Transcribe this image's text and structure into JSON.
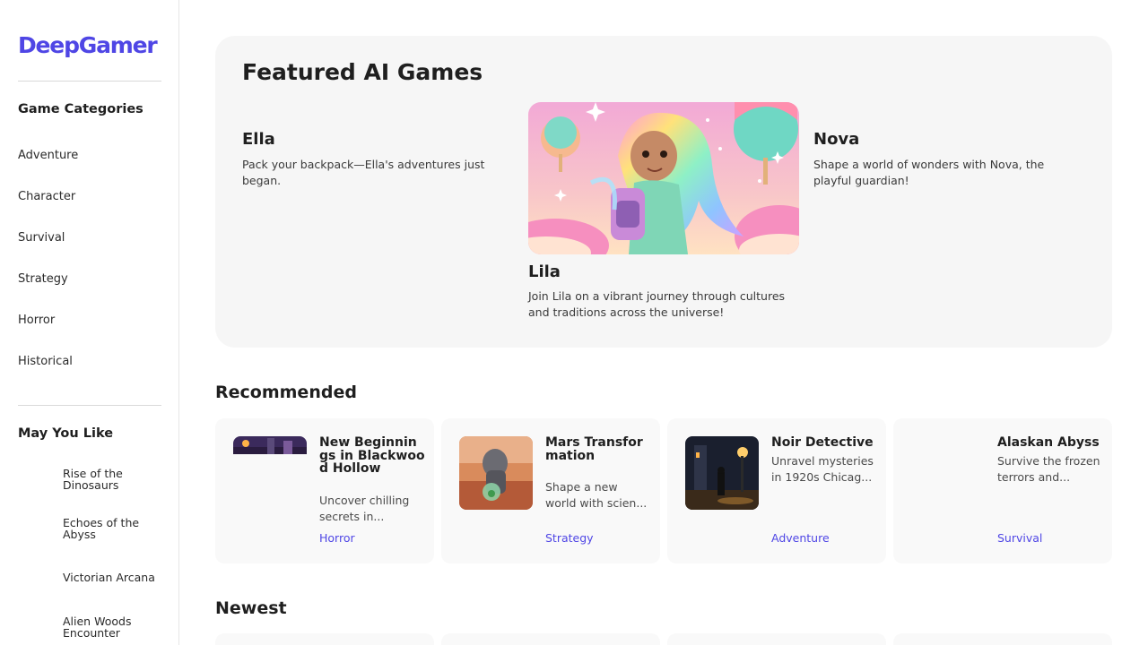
{
  "sidebar": {
    "logo": "DeepGamer",
    "categories_heading": "Game Categories",
    "categories": [
      "Adventure",
      "Character",
      "Survival",
      "Strategy",
      "Horror",
      "Historical"
    ],
    "may_you_like_heading": "May You Like",
    "may_you_like": [
      "Rise of the Dinosaurs",
      "Echoes of the Abyss",
      "Victorian Arcana",
      "Alien Woods Encounter"
    ]
  },
  "featured": {
    "title": "Featured AI Games",
    "games": [
      {
        "name": "Ella",
        "description": "Pack your backpack—Ella's adventures just began."
      },
      {
        "name": "Lila",
        "description": "Join Lila on a vibrant journey through cultures and traditions across the universe!"
      },
      {
        "name": "Nova",
        "description": "Shape a world of wonders with Nova, the playful guardian!"
      }
    ]
  },
  "recommended": {
    "title": "Recommended",
    "cards": [
      {
        "title": "New Beginnings in Blackwood Hollow",
        "description": "Uncover chilling secrets in...",
        "tag": "Horror"
      },
      {
        "title": "Mars Transformation",
        "description": "Shape a new world with scien...",
        "tag": "Strategy"
      },
      {
        "title": "Noir Detective",
        "description": "Unravel mysteries in 1920s Chicag...",
        "tag": "Adventure"
      },
      {
        "title": "Alaskan Abyss",
        "description": "Survive the frozen terrors and...",
        "tag": "Survival"
      }
    ]
  },
  "newest": {
    "title": "Newest"
  },
  "colors": {
    "accent": "#4f46e5",
    "panel": "#f6f6f6"
  }
}
